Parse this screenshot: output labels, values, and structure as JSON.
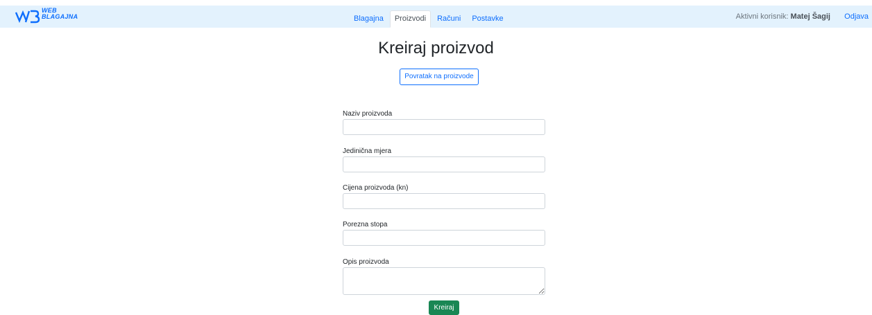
{
  "header": {
    "logo_mark": "W/B",
    "logo_text_line1": "WEB",
    "logo_text_line2": "BLAGAJNA",
    "nav": [
      {
        "label": "Blagajna",
        "active": false
      },
      {
        "label": "Proizvodi",
        "active": true
      },
      {
        "label": "Računi",
        "active": false
      },
      {
        "label": "Postavke",
        "active": false
      }
    ],
    "user_prefix": "Aktivni korisnik:",
    "user_name": "Matej Šagij",
    "logout_label": "Odjava"
  },
  "page": {
    "title": "Kreiraj proizvod",
    "back_button": "Povratak na proizvode"
  },
  "form": {
    "fields": [
      {
        "label": "Naziv proizvoda",
        "value": ""
      },
      {
        "label": "Jedinična mjera",
        "value": ""
      },
      {
        "label": "Cijena proizvoda (kn)",
        "value": ""
      },
      {
        "label": "Porezna stopa",
        "value": ""
      },
      {
        "label": "Opis proizvoda",
        "value": ""
      }
    ],
    "submit_label": "Kreiraj"
  },
  "colors": {
    "navbar_bg": "#e3f2fd",
    "primary": "#0d6efd",
    "success": "#198754"
  }
}
